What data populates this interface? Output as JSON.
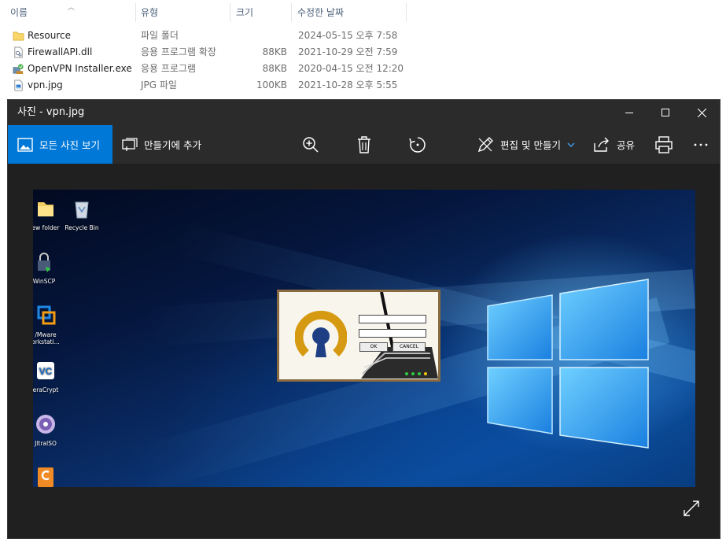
{
  "explorer": {
    "columns": {
      "name": "이름",
      "type": "유형",
      "size": "크기",
      "modified": "수정한 날짜"
    },
    "files": [
      {
        "name": "Resource",
        "type": "파일 폴더",
        "size": "",
        "modified": "2024-05-15 오후 7:58",
        "icon": "folder-icon"
      },
      {
        "name": "FirewallAPI.dll",
        "type": "응용 프로그램 확장",
        "size": "88KB",
        "modified": "2021-10-29 오전 7:59",
        "icon": "dll-file-icon"
      },
      {
        "name": "OpenVPN Installer.exe",
        "type": "응용 프로그램",
        "size": "88KB",
        "modified": "2020-04-15 오전 12:20",
        "icon": "exe-file-icon"
      },
      {
        "name": "vpn.jpg",
        "type": "JPG 파일",
        "size": "100KB",
        "modified": "2021-10-28 오후 5:55",
        "icon": "image-file-icon"
      }
    ]
  },
  "photos": {
    "title": "사진 - vpn.jpg",
    "toolbar": {
      "all_photos": "모든 사진 보기",
      "add_to_creation": "만들기에 추가",
      "edit_create": "편집 및 만들기",
      "share": "공유"
    },
    "accent_color": "#0078d7",
    "image": {
      "desktop_icons": [
        "ew folder",
        "Recycle Bin",
        "WinSCP",
        "/Mware",
        "orkstati...",
        "eraCrypt",
        "JltraISO"
      ],
      "dialog": {
        "ok": "OK",
        "cancel": "CANCEL"
      }
    }
  }
}
